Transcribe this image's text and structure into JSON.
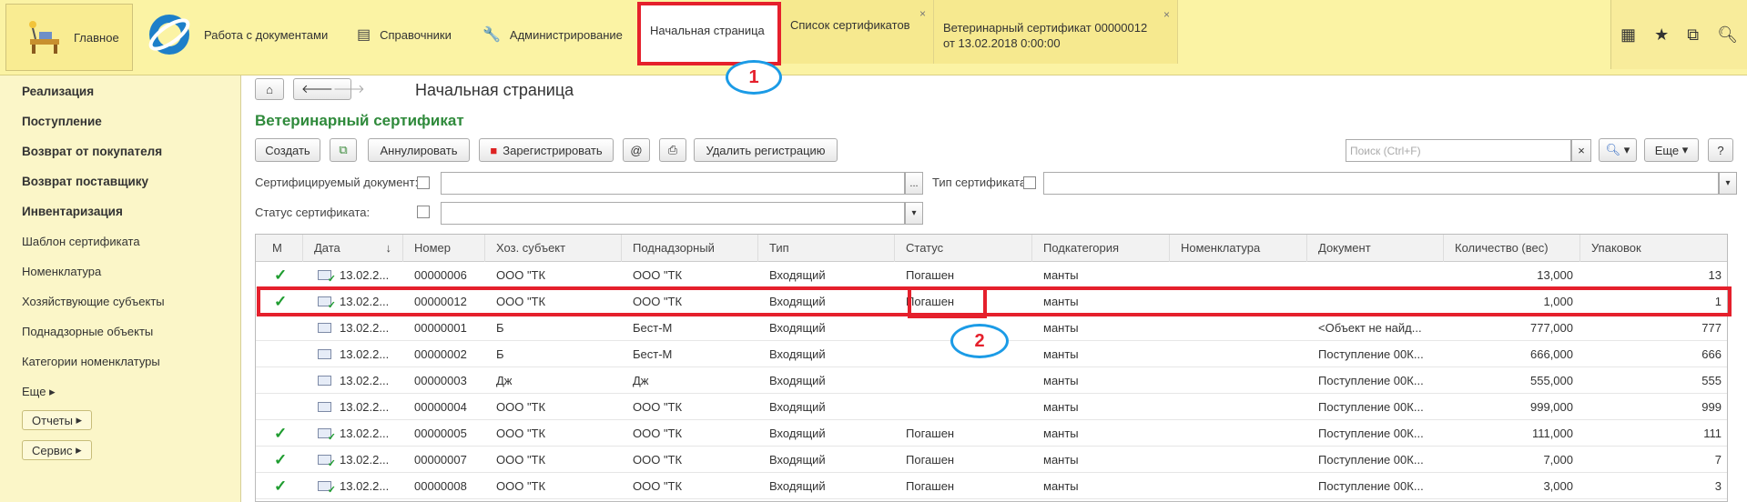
{
  "topbar": {
    "home_label": "Главное",
    "sections": [
      {
        "label": "Работа с документами",
        "icon": "logo-icon"
      },
      {
        "label": "Справочники",
        "icon": "list-icon"
      },
      {
        "label": "Администрирование",
        "icon": "wrench-icon"
      }
    ],
    "tabs": [
      {
        "label": "Начальная страница",
        "active": true
      },
      {
        "label": "Список сертификатов",
        "closable": true
      },
      {
        "label_line1": "Ветеринарный сертификат 00000012",
        "label_line2": "от 13.02.2018 0:00:00",
        "closable": true
      }
    ],
    "close_glyph": "×",
    "right_icons": [
      "apps-icon",
      "star-icon",
      "history-icon",
      "search-icon"
    ]
  },
  "sidebar": {
    "bold_items": [
      "Реализация",
      "Поступление",
      "Возврат от покупателя",
      "Возврат поставщику",
      "Инвентаризация"
    ],
    "items": [
      "Шаблон сертификата",
      "Номенклатура",
      "Хозяйствующие субъекты",
      "Поднадзорные объекты",
      "Категории номенклатуры"
    ],
    "more_label": "Еще",
    "buttons": [
      "Отчеты",
      "Сервис"
    ]
  },
  "main": {
    "page_title": "Начальная страница",
    "section_title": "Ветеринарный сертификат",
    "toolbar": {
      "create": "Создать",
      "annul": "Аннулировать",
      "register": "Зарегистрировать",
      "at": "@",
      "delete_reg": "Удалить регистрацию",
      "search_placeholder": "Поиск (Ctrl+F)",
      "more": "Еще",
      "help": "?"
    },
    "filters": {
      "doc_label": "Сертифицируемый документ:",
      "type_label": "Тип сертификата:",
      "status_label": "Статус сертификата:",
      "dots": "..."
    },
    "table": {
      "columns": [
        "М",
        "Дата",
        "Номер",
        "Хоз. субъект",
        "Поднадзорный",
        "Тип",
        "Статус",
        "Подкатегория",
        "Номенклатура",
        "Документ",
        "Количество (вес)",
        "Упаковок"
      ],
      "sort_glyph": "↓",
      "rows": [
        {
          "mark": "✓",
          "ok": true,
          "date": "13.02.2...",
          "num": "00000006",
          "subj": "ООО \"ТК",
          "sup": "ООО \"ТК",
          "type": "Входящий",
          "status": "Погашен",
          "sub": "манты",
          "nom": "",
          "doc": "",
          "qty": "13,000",
          "pack": "13"
        },
        {
          "mark": "✓",
          "ok": true,
          "date": "13.02.2...",
          "num": "00000012",
          "subj": "ООО \"ТК",
          "sup": "ООО \"ТК",
          "type": "Входящий",
          "status": "Погашен",
          "sub": "манты",
          "nom": "",
          "doc": "",
          "qty": "1,000",
          "pack": "1"
        },
        {
          "mark": "",
          "ok": false,
          "date": "13.02.2...",
          "num": "00000001",
          "subj": "Б",
          "sup": "Бест-М",
          "type": "Входящий",
          "status": "",
          "sub": "манты",
          "nom": "",
          "doc": "<Объект не найд...",
          "qty": "777,000",
          "pack": "777"
        },
        {
          "mark": "",
          "ok": false,
          "date": "13.02.2...",
          "num": "00000002",
          "subj": "Б",
          "sup": "Бест-М",
          "type": "Входящий",
          "status": "",
          "sub": "манты",
          "nom": "",
          "doc": "Поступление 00К...",
          "qty": "666,000",
          "pack": "666"
        },
        {
          "mark": "",
          "ok": false,
          "date": "13.02.2...",
          "num": "00000003",
          "subj": "Дж",
          "sup": "Дж",
          "type": "Входящий",
          "status": "",
          "sub": "манты",
          "nom": "",
          "doc": "Поступление 00К...",
          "qty": "555,000",
          "pack": "555"
        },
        {
          "mark": "",
          "ok": false,
          "date": "13.02.2...",
          "num": "00000004",
          "subj": "ООО \"ТК",
          "sup": "ООО \"ТК",
          "type": "Входящий",
          "status": "",
          "sub": "манты",
          "nom": "",
          "doc": "Поступление 00К...",
          "qty": "999,000",
          "pack": "999"
        },
        {
          "mark": "✓",
          "ok": true,
          "date": "13.02.2...",
          "num": "00000005",
          "subj": "ООО \"ТК",
          "sup": "ООО \"ТК",
          "type": "Входящий",
          "status": "Погашен",
          "sub": "манты",
          "nom": "",
          "doc": "Поступление 00К...",
          "qty": "111,000",
          "pack": "111"
        },
        {
          "mark": "✓",
          "ok": true,
          "date": "13.02.2...",
          "num": "00000007",
          "subj": "ООО \"ТК",
          "sup": "ООО \"ТК",
          "type": "Входящий",
          "status": "Погашен",
          "sub": "манты",
          "nom": "",
          "doc": "Поступление 00К...",
          "qty": "7,000",
          "pack": "7"
        },
        {
          "mark": "✓",
          "ok": true,
          "date": "13.02.2...",
          "num": "00000008",
          "subj": "ООО \"ТК",
          "sup": "ООО \"ТК",
          "type": "Входящий",
          "status": "Погашен",
          "sub": "манты",
          "nom": "",
          "doc": "Поступление 00К...",
          "qty": "3,000",
          "pack": "3"
        }
      ]
    }
  },
  "annotations": {
    "one": "1",
    "two": "2"
  },
  "colors": {
    "accent_red": "#e5202c",
    "ellipse_blue": "#1b9be6",
    "section_green": "#2f8a3b",
    "topbar_yellow": "#fbf3a4"
  }
}
